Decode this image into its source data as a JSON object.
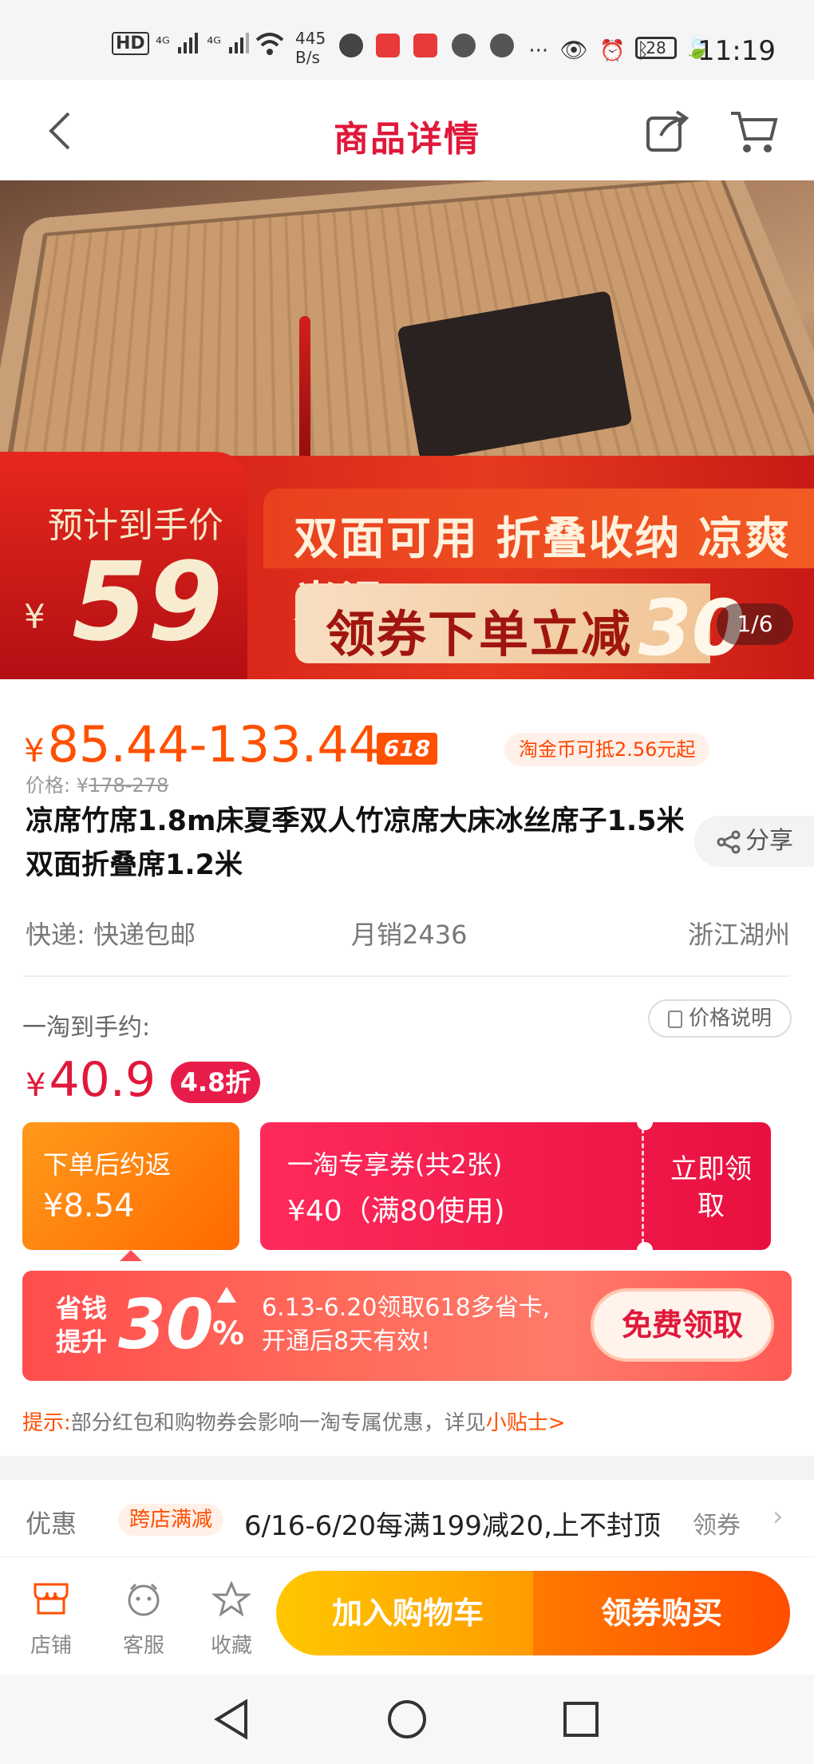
{
  "status_bar": {
    "network": "HD 4G 4G",
    "speed": "445\nB/s",
    "battery": "28",
    "time": "11:19"
  },
  "header": {
    "title": "商品详情",
    "back_icon": "chevron-left-icon",
    "share_icon": "share-box-icon",
    "cart_icon": "cart-icon"
  },
  "banner": {
    "price_label": "预计到手价",
    "currency": "¥",
    "price": "59",
    "slogan": "双面可用 折叠收纳 凉爽光滑",
    "coupon_text": "领券下单立减",
    "coupon_amount": "30",
    "page_indicator": "1/6"
  },
  "product": {
    "currency": "¥",
    "price_range": "85.44-133.44",
    "tag": "618",
    "coin_note": "淘金币可抵2.56元起",
    "orig_label": "价格: ¥",
    "orig_price": "178-278",
    "title": "凉席竹席1.8m床夏季双人竹凉席大床冰丝席子1.5米双面折叠席1.2米",
    "share_label": "分享",
    "shipping": "快递: 快递包邮",
    "sales": "月销2436",
    "location": "浙江湖州"
  },
  "yitao": {
    "label": "一淘到手约:",
    "price_note": "价格说明",
    "currency": "¥",
    "price": "40.9",
    "discount": "4.8折",
    "rebate_title": "下单后约返",
    "rebate_amount": "¥8.54",
    "voucher_title": "一淘专享券(共2张)",
    "voucher_detail": "¥40（满80使用)",
    "voucher_claim": "立即领取"
  },
  "saving_card": {
    "left_text": "省钱\n提升",
    "big": "30",
    "pct": "%",
    "info_line1": "6.13-6.20领取618多省卡,",
    "info_line2": "开通后8天有效!",
    "button": "免费领取"
  },
  "tip": {
    "key": "提示:",
    "text": "部分红包和购物券会影响一淘专属优惠，详见",
    "link": "小贴士>"
  },
  "promo": {
    "label": "优惠",
    "tag": "跨店满减",
    "text": "6/16-6/20每满199减20,上不封顶",
    "action": "领券"
  },
  "bottom_bar": {
    "shop_label": "店铺",
    "service_label": "客服",
    "fav_label": "收藏",
    "cart_button": "加入购物车",
    "buy_button": "领券购买"
  },
  "colors": {
    "brand_red": "#e0183a",
    "price_orange": "#ff5000",
    "cart_yellow": "#ffc700"
  }
}
